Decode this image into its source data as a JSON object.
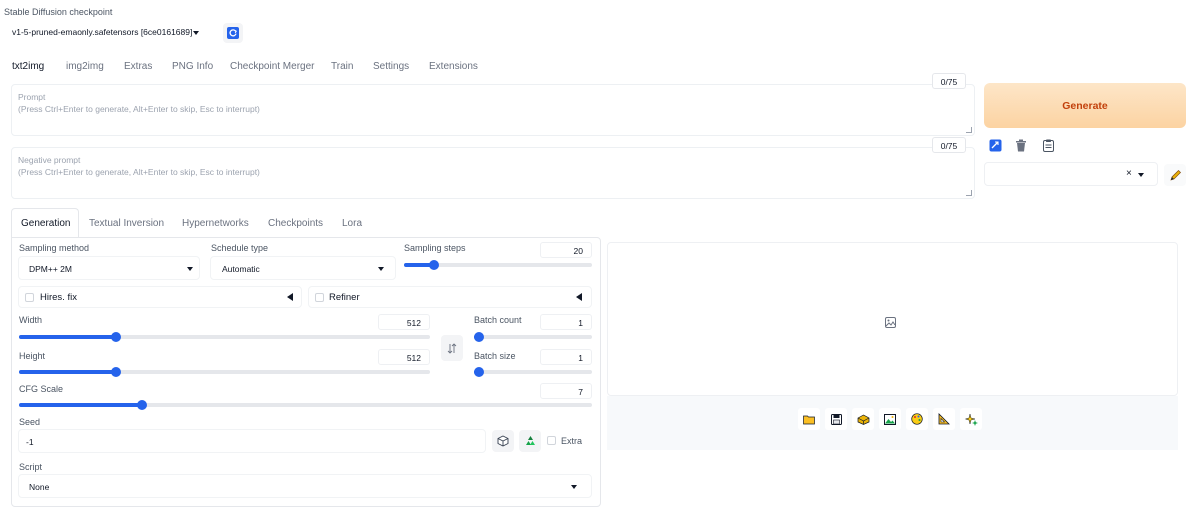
{
  "checkpoint": {
    "label": "Stable Diffusion checkpoint",
    "value": "v1-5-pruned-emaonly.safetensors [6ce0161689]"
  },
  "main_tabs": [
    "txt2img",
    "img2img",
    "Extras",
    "PNG Info",
    "Checkpoint Merger",
    "Train",
    "Settings",
    "Extensions"
  ],
  "prompt": {
    "label": "Prompt",
    "placeholder": "(Press Ctrl+Enter to generate, Alt+Enter to skip, Esc to interrupt)",
    "counter": "0/75"
  },
  "negative_prompt": {
    "label": "Negative prompt",
    "placeholder": "(Press Ctrl+Enter to generate, Alt+Enter to skip, Esc to interrupt)",
    "counter": "0/75"
  },
  "generate_label": "Generate",
  "style_clear": "×",
  "sub_tabs": [
    "Generation",
    "Textual Inversion",
    "Hypernetworks",
    "Checkpoints",
    "Lora"
  ],
  "sampling_method": {
    "label": "Sampling method",
    "value": "DPM++ 2M"
  },
  "schedule_type": {
    "label": "Schedule type",
    "value": "Automatic"
  },
  "sampling_steps": {
    "label": "Sampling steps",
    "value": "20",
    "fraction": 0.14
  },
  "hires_fix": {
    "label": "Hires. fix"
  },
  "refiner": {
    "label": "Refiner"
  },
  "width": {
    "label": "Width",
    "value": "512",
    "fraction": 0.23
  },
  "height": {
    "label": "Height",
    "value": "512",
    "fraction": 0.23
  },
  "batch_count": {
    "label": "Batch count",
    "value": "1",
    "fraction": 0.0
  },
  "batch_size": {
    "label": "Batch size",
    "value": "1",
    "fraction": 0.0
  },
  "cfg_scale": {
    "label": "CFG Scale",
    "value": "7",
    "fraction": 0.21
  },
  "seed": {
    "label": "Seed",
    "value": "-1",
    "extra_label": "Extra"
  },
  "script": {
    "label": "Script",
    "value": "None"
  },
  "colors": {
    "accent": "#2563eb",
    "generate_bg": "#fdd9b0",
    "generate_text": "#c2410c"
  }
}
